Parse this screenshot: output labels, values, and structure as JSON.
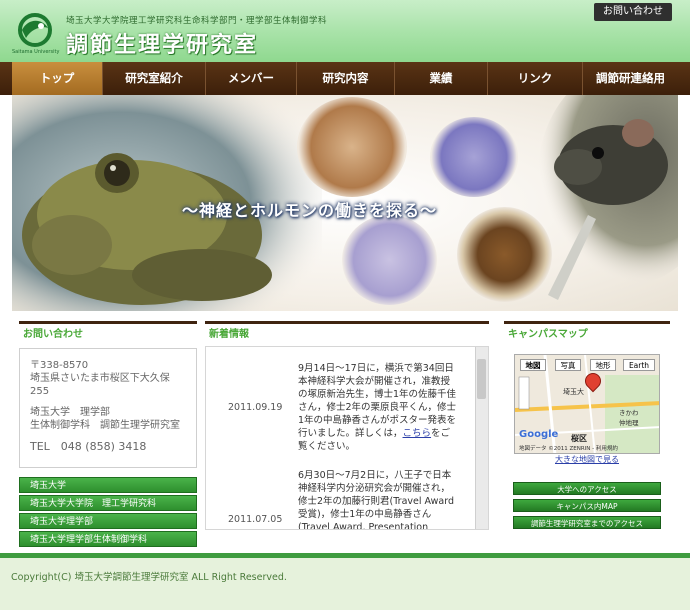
{
  "header": {
    "logo_caption": "Saitama University",
    "department": "埼玉大学大学院理工学研究科生命科学部門・理学部生体制御学科",
    "title": "調節生理学研究室",
    "contact_button": "お問い合わせ"
  },
  "nav": {
    "items": [
      {
        "label": "トップ",
        "active": true
      },
      {
        "label": "研究室紹介",
        "active": false
      },
      {
        "label": "メンバー",
        "active": false
      },
      {
        "label": "研究内容",
        "active": false
      },
      {
        "label": "業績",
        "active": false
      },
      {
        "label": "リンク",
        "active": false
      },
      {
        "label": "調節研連絡用",
        "active": false
      }
    ]
  },
  "hero": {
    "slogan": "～神経とホルモンの働きを探る～"
  },
  "contact": {
    "heading": "お問い合わせ",
    "postal": "〒338-8570",
    "address1": "埼玉県さいたま市桜区下大久保",
    "address2": "255",
    "org1": "埼玉大学　理学部",
    "org2": "生体制御学科　調節生理学研究室",
    "tel": "TEL　048 (858) 3418"
  },
  "links": [
    "埼玉大学",
    "埼玉大学大学院　理工学研究科",
    "埼玉大学理学部",
    "埼玉大学理学部生体制御学科"
  ],
  "news": {
    "heading": "新着情報",
    "items": [
      {
        "date": "2011.09.19",
        "text": "9月14日～17日に，横浜で第34回日本神経科学大会が開催され，准教授の塚原新治先生，博士1年の佐藤千佳さん，修士2年の栗原良平くん，修士1年の中島静香さんがポスター発表を行いました。詳しくは，",
        "link": "こちら",
        "text_after": "をご覧ください。"
      },
      {
        "date": "2011.07.05",
        "text": "6月30日～7月2日に，八王子で日本神経科学内分泌研究会が開催され，修士2年の加藤行則君(Travel Award受賞)，修士1年の中島静香さん(Travel Award, Presentation"
      }
    ]
  },
  "campus": {
    "heading": "キャンパスマップ",
    "map_tabs": [
      "地図",
      "写真",
      "地形",
      "Earth"
    ],
    "map_labels": {
      "area1": "埼玉大",
      "area2": "きかわ",
      "area3": "仲地理",
      "area4": "桜区",
      "copyright": "地図データ ©2011 ZENRIN - 利用規約",
      "google": "Google"
    },
    "map_link": "大きな地図で見る",
    "buttons": [
      "大学へのアクセス",
      "キャンパス内MAP",
      "調節生理学研究室までのアクセス"
    ]
  },
  "footer": {
    "copyright": "Copyright(C) 埼玉大学調節生理学研究室 ALL Right Reserved."
  },
  "colors": {
    "header_green": "#a7e2a7",
    "nav_brown": "#4a2a10",
    "nav_active": "#b97b2c",
    "section_green": "#4aa838",
    "link_blue": "#2b3fa8"
  }
}
